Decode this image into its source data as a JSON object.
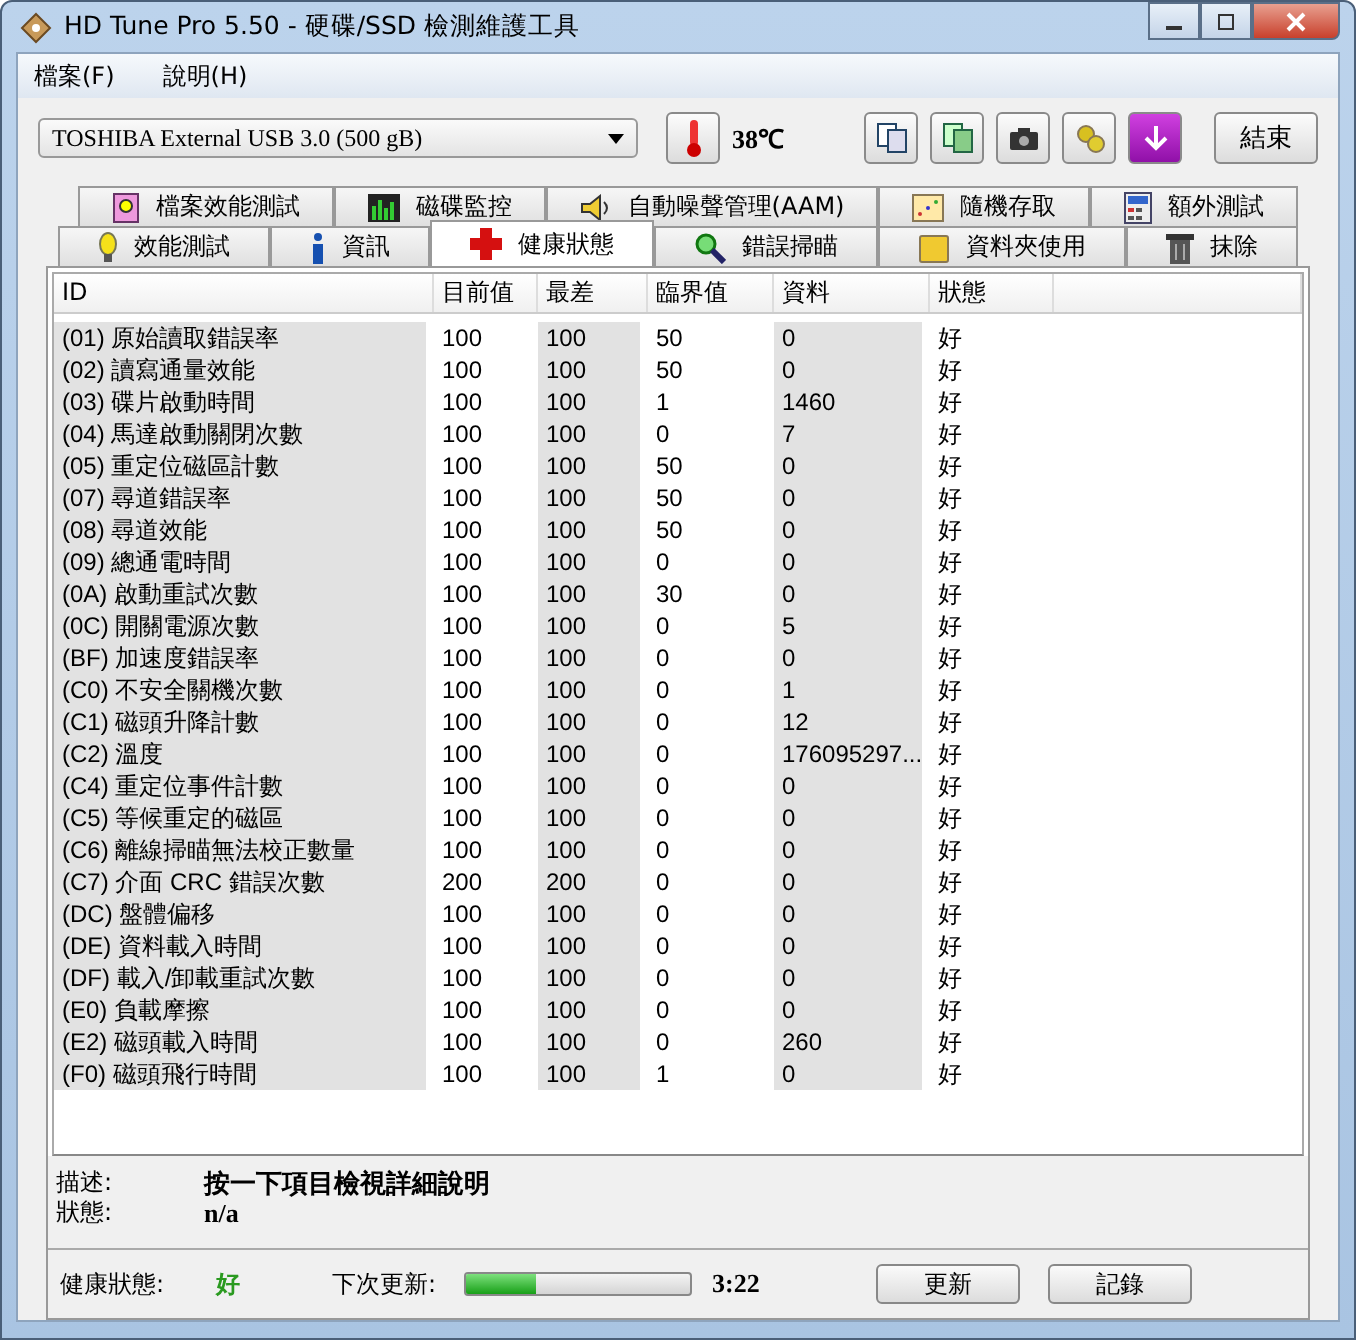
{
  "window": {
    "title": "HD Tune Pro 5.50 - 硬碟/SSD 檢測維護工具"
  },
  "menu": [
    {
      "label": "檔案(F)"
    },
    {
      "label": "說明(H)"
    }
  ],
  "toolbar": {
    "drive": "TOSHIBA External USB 3.0 (500 gB)",
    "temperature": "38℃",
    "exit_button": "結束"
  },
  "tabs": {
    "back_row": [
      {
        "label": "檔案效能測試",
        "selected": false
      },
      {
        "label": "磁碟監控",
        "selected": false
      },
      {
        "label": "自動噪聲管理(AAM)",
        "selected": false
      },
      {
        "label": "隨機存取",
        "selected": false
      },
      {
        "label": "額外測試",
        "selected": false
      }
    ],
    "front_row": [
      {
        "label": "效能測試",
        "selected": false
      },
      {
        "label": "資訊",
        "selected": false
      },
      {
        "label": "健康狀態",
        "selected": true
      },
      {
        "label": "錯誤掃瞄",
        "selected": false
      },
      {
        "label": "資料夾使用",
        "selected": false
      },
      {
        "label": "抹除",
        "selected": false
      }
    ]
  },
  "table": {
    "columns": [
      "ID",
      "目前值",
      "最差",
      "臨界值",
      "資料",
      "狀態"
    ],
    "rows": [
      [
        "(01) 原始讀取錯誤率",
        "100",
        "100",
        "50",
        "0",
        "好"
      ],
      [
        "(02) 讀寫通量效能",
        "100",
        "100",
        "50",
        "0",
        "好"
      ],
      [
        "(03) 碟片啟動時間",
        "100",
        "100",
        "1",
        "1460",
        "好"
      ],
      [
        "(04) 馬達啟動關閉次數",
        "100",
        "100",
        "0",
        "7",
        "好"
      ],
      [
        "(05) 重定位磁區計數",
        "100",
        "100",
        "50",
        "0",
        "好"
      ],
      [
        "(07) 尋道錯誤率",
        "100",
        "100",
        "50",
        "0",
        "好"
      ],
      [
        "(08) 尋道效能",
        "100",
        "100",
        "50",
        "0",
        "好"
      ],
      [
        "(09) 總通電時間",
        "100",
        "100",
        "0",
        "0",
        "好"
      ],
      [
        "(0A) 啟動重試次數",
        "100",
        "100",
        "30",
        "0",
        "好"
      ],
      [
        "(0C) 開關電源次數",
        "100",
        "100",
        "0",
        "5",
        "好"
      ],
      [
        "(BF) 加速度錯誤率",
        "100",
        "100",
        "0",
        "0",
        "好"
      ],
      [
        "(C0) 不安全關機次數",
        "100",
        "100",
        "0",
        "1",
        "好"
      ],
      [
        "(C1) 磁頭升降計數",
        "100",
        "100",
        "0",
        "12",
        "好"
      ],
      [
        "(C2) 溫度",
        "100",
        "100",
        "0",
        "176095297...",
        "好"
      ],
      [
        "(C4) 重定位事件計數",
        "100",
        "100",
        "0",
        "0",
        "好"
      ],
      [
        "(C5) 等候重定的磁區",
        "100",
        "100",
        "0",
        "0",
        "好"
      ],
      [
        "(C6) 離線掃瞄無法校正數量",
        "100",
        "100",
        "0",
        "0",
        "好"
      ],
      [
        "(C7) 介面 CRC 錯誤次數",
        "200",
        "200",
        "0",
        "0",
        "好"
      ],
      [
        "(DC) 盤體偏移",
        "100",
        "100",
        "0",
        "0",
        "好"
      ],
      [
        "(DE) 資料載入時間",
        "100",
        "100",
        "0",
        "0",
        "好"
      ],
      [
        "(DF) 載入/卸載重試次數",
        "100",
        "100",
        "0",
        "0",
        "好"
      ],
      [
        "(E0) 負載摩擦",
        "100",
        "100",
        "0",
        "0",
        "好"
      ],
      [
        "(E2) 磁頭載入時間",
        "100",
        "100",
        "0",
        "260",
        "好"
      ],
      [
        "(F0) 磁頭飛行時間",
        "100",
        "100",
        "1",
        "0",
        "好"
      ]
    ]
  },
  "details": [
    {
      "label": "描述:",
      "value": "按一下項目檢視詳細說明"
    },
    {
      "label": "狀態:",
      "value": "n/a"
    }
  ],
  "footer": {
    "health_label": "健康狀態:",
    "health_value": "好",
    "next_update_label": "下次更新:",
    "level": 0.31,
    "time": "3:22",
    "buttons": [
      "更新",
      "記錄"
    ]
  }
}
